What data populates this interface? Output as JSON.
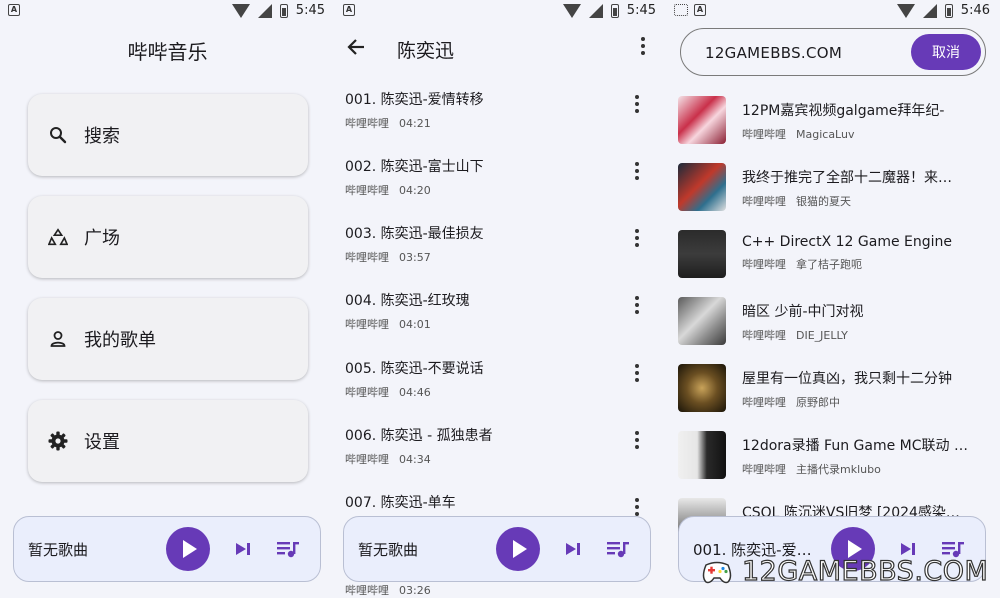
{
  "panels": {
    "home": {
      "status": {
        "time": "5:45"
      },
      "title": "哔哔音乐",
      "menu": [
        {
          "label": "搜索",
          "icon": "search-icon"
        },
        {
          "label": "广场",
          "icon": "recycle-icon"
        },
        {
          "label": "我的歌单",
          "icon": "person-icon"
        },
        {
          "label": "设置",
          "icon": "gear-icon"
        }
      ],
      "player": {
        "now_playing": "暂无歌曲"
      }
    },
    "playlist": {
      "status": {
        "time": "5:45"
      },
      "title": "陈奕迅",
      "songs": [
        {
          "title": "001. 陈奕迅-爱情转移",
          "source": "哔哩哔哩",
          "duration": "04:21"
        },
        {
          "title": "002. 陈奕迅-富士山下",
          "source": "哔哩哔哩",
          "duration": "04:20"
        },
        {
          "title": "003. 陈奕迅-最佳损友",
          "source": "哔哩哔哩",
          "duration": "03:57"
        },
        {
          "title": "004. 陈奕迅-红玫瑰",
          "source": "哔哩哔哩",
          "duration": "04:01"
        },
        {
          "title": "005. 陈奕迅-不要说话",
          "source": "哔哩哔哩",
          "duration": "04:46"
        },
        {
          "title": "006. 陈奕迅 - 孤独患者",
          "source": "哔哩哔哩",
          "duration": "04:34"
        },
        {
          "title": "007. 陈奕迅-单车",
          "source": "",
          "duration": ""
        }
      ],
      "hidden_row": {
        "source": "哔哩哔哩",
        "duration": "03:26"
      },
      "player": {
        "now_playing": "暂无歌曲"
      }
    },
    "search": {
      "status": {
        "time": "5:46"
      },
      "query": "12GAMEBBS.COM",
      "cancel_label": "取消",
      "results": [
        {
          "title": "12PM嘉宾视频galgame拜年纪-",
          "source": "哔哩哔哩",
          "uploader": "MagicaLuv"
        },
        {
          "title": "我终于推完了全部十二魔器！来…",
          "source": "哔哩哔哩",
          "uploader": "银猫的夏天"
        },
        {
          "title": "C++ DirectX 12 Game Engine",
          "source": "哔哩哔哩",
          "uploader": "拿了桔子跑呃"
        },
        {
          "title": "暗区 少前-中门对视",
          "source": "哔哩哔哩",
          "uploader": "DIE_JELLY"
        },
        {
          "title": "屋里有一位真凶，我只剩十二分钟",
          "source": "哔哩哔哩",
          "uploader": "原野郎中"
        },
        {
          "title": "12dora录播 Fun Game MC联动 …",
          "source": "哔哩哔哩",
          "uploader": "主播代录mklubo"
        },
        {
          "title": "CSOL 陈沉迷VS旧梦 [2024感染…",
          "source": "",
          "uploader": ""
        }
      ],
      "player": {
        "now_playing": "001. 陈奕迅-爱…"
      },
      "watermark": "12GAMEBBS.COM"
    }
  },
  "colors": {
    "accent": "#673ab7",
    "panel_bg": "#f3f4fa",
    "card_bg": "#f1f1f3",
    "player_bg": "#eaeefc"
  }
}
